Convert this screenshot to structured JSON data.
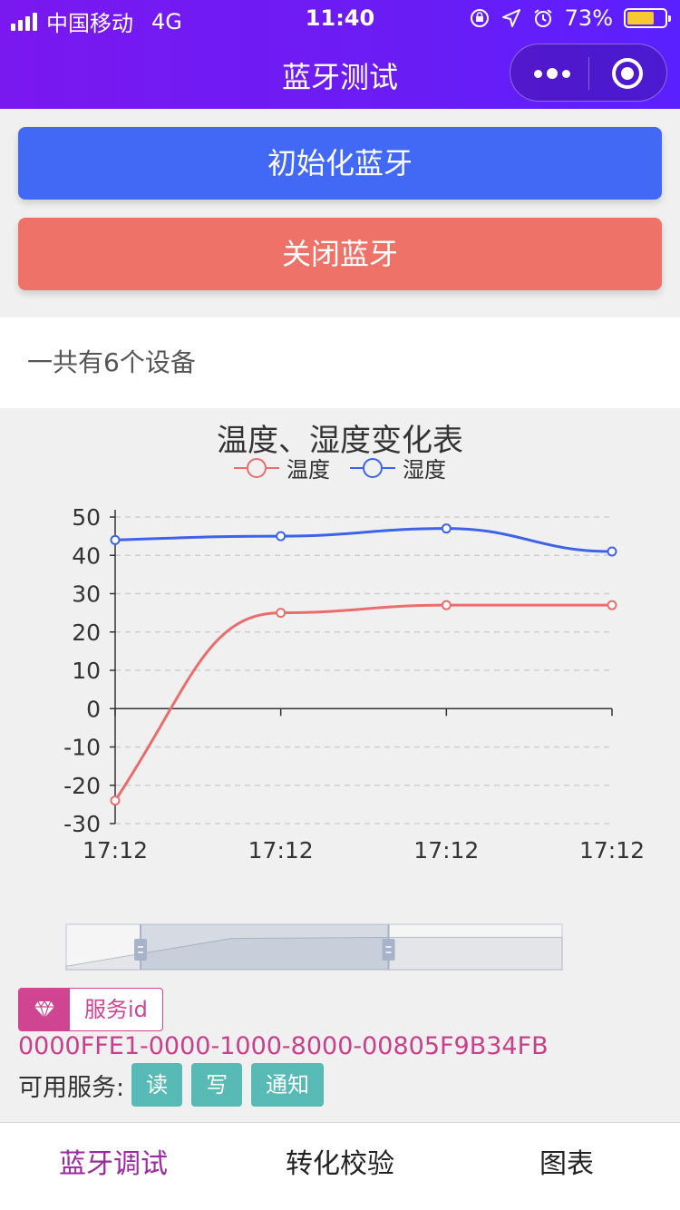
{
  "status_bar": {
    "carrier": "中国移动",
    "network": "4G",
    "time": "11:40",
    "battery": "73%",
    "battery_level": 0.73,
    "icons": [
      "signal-icon",
      "orientation-lock-icon",
      "location-icon",
      "alarm-icon",
      "battery-icon"
    ]
  },
  "nav": {
    "title": "蓝牙测试",
    "more_icon": "more-dots-icon",
    "close_icon": "target-circle-icon"
  },
  "buttons": {
    "init": "初始化蓝牙",
    "close": "关闭蓝牙"
  },
  "colors": {
    "header_gradient": [
      "#7a18f0",
      "#5b20ff"
    ],
    "init_button": "#4169f6",
    "close_button": "#ef7268",
    "accent": "#c8408a",
    "pill": "#58bab4",
    "active_tab": "#9b2aa0"
  },
  "device_count": "一共有6个设备",
  "chart_data": {
    "type": "line",
    "title": "温度、湿度变化表",
    "categories": [
      "17:12",
      "17:12",
      "17:12",
      "17:12"
    ],
    "series": [
      {
        "name": "温度",
        "color": "#e86d6d",
        "values": [
          -24,
          25,
          27,
          27
        ]
      },
      {
        "name": "湿度",
        "color": "#3e63e8",
        "values": [
          44,
          45,
          47,
          41
        ]
      }
    ],
    "yticks": [
      50,
      40,
      30,
      20,
      10,
      0,
      -10,
      -20,
      -30
    ],
    "ylim": [
      -30,
      50
    ],
    "grid": "dashed-horizontal",
    "legend": "top-center",
    "smooth": true,
    "datazoom": {
      "start": 0.15,
      "end": 0.65
    }
  },
  "service": {
    "tag_icon": "diamond-icon",
    "tag_label": "服务id",
    "uuid": "0000FFE1-0000-1000-8000-00805F9B34FB",
    "available_label": "可用服务:",
    "actions": [
      "读",
      "写",
      "通知"
    ]
  },
  "tabbar": {
    "tabs": [
      "蓝牙调试",
      "转化校验",
      "图表"
    ],
    "active": 0
  }
}
